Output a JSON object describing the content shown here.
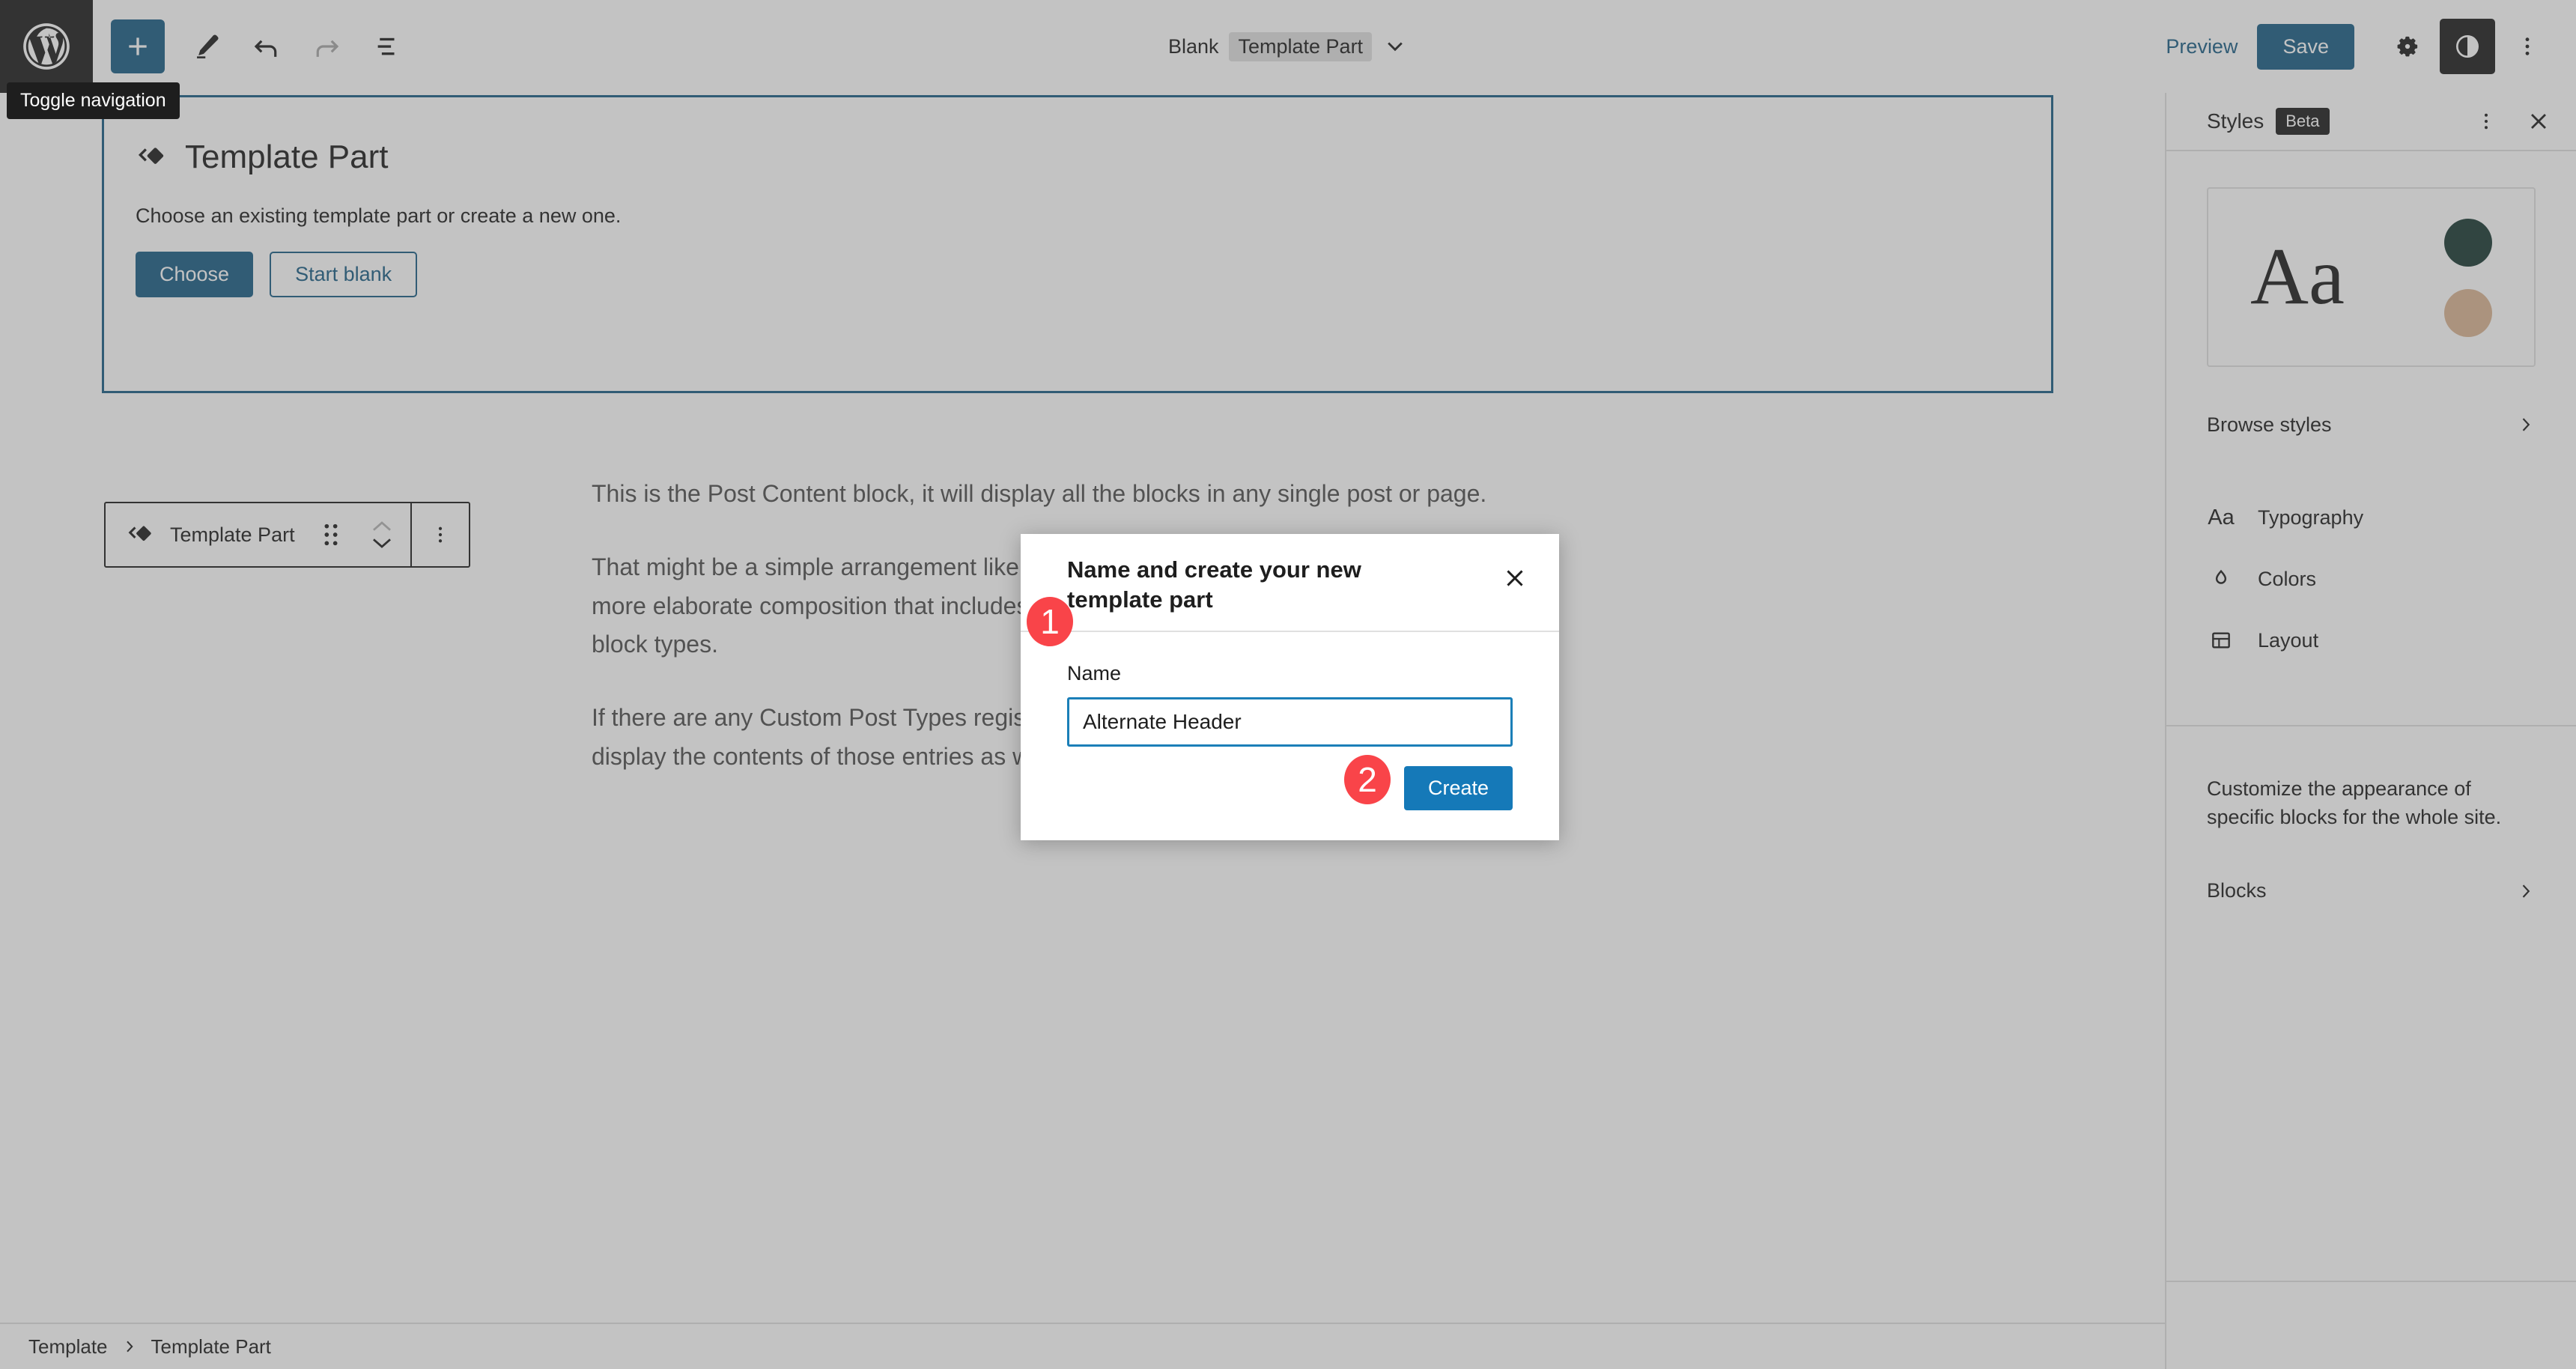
{
  "toolbar": {
    "wp_logo_icon": "wordpress-logo-icon",
    "add_block_icon": "plus-icon",
    "edit_icon": "pencil-icon",
    "undo_icon": "undo-arrow-icon",
    "redo_icon": "redo-arrow-icon",
    "list_view_icon": "list-view-icon",
    "tooltip": "Toggle navigation",
    "document_title": "Blank",
    "document_type_badge": "Template Part",
    "document_chevron_icon": "chevron-down-icon",
    "preview_label": "Preview",
    "save_label": "Save",
    "settings_icon": "gear-icon",
    "styles_icon": "contrast-half-circle-icon",
    "more_options_icon": "three-dots-vertical-icon"
  },
  "editor": {
    "template_part_block": {
      "icon": "template-part-icon",
      "heading": "Template Part",
      "description": "Choose an existing template part or create a new one.",
      "choose_label": "Choose",
      "start_blank_label": "Start blank"
    },
    "block_toolbar": {
      "block_icon": "template-part-icon",
      "block_label": "Template Part",
      "drag_handle_icon": "drag-handle-dots-icon",
      "move_up_icon": "chevron-up-icon",
      "move_down_icon": "chevron-down-icon",
      "options_icon": "three-dots-vertical-icon"
    },
    "post_content_paragraphs": [
      "This is the Post Content block, it will display all the blocks in any single post or page.",
      "That might be a simple arrangement like consecutive paragraphs in a blog post, or a more elaborate composition that includes video, image galleries, columns, and any other block types.",
      "If there are any Custom Post Types registered at your site, the Post Content block can display the contents of those entries as well."
    ]
  },
  "breadcrumb": {
    "items": [
      "Template",
      "Template Part"
    ],
    "separator_icon": "chevron-right-icon"
  },
  "sidebar": {
    "title": "Styles",
    "beta_badge": "Beta",
    "more_options_icon": "three-dots-vertical-icon",
    "close_icon": "close-x-icon",
    "preview": {
      "sample_text": "Aa",
      "swatch_primary_color": "#1b3a35",
      "swatch_secondary_color": "#d9b593"
    },
    "browse_styles": {
      "label": "Browse styles",
      "chevron_icon": "chevron-right-icon"
    },
    "menu_items": [
      {
        "label": "Typography",
        "icon": "typography-aa-icon"
      },
      {
        "label": "Colors",
        "icon": "color-droplet-icon"
      },
      {
        "label": "Layout",
        "icon": "layout-panel-icon"
      }
    ],
    "blocks_help_text": "Customize the appearance of specific blocks for the whole site.",
    "blocks_row": {
      "label": "Blocks",
      "chevron_icon": "chevron-right-icon"
    }
  },
  "modal": {
    "title": "Name and create your new template part",
    "close_icon": "close-x-icon",
    "name_label": "Name",
    "name_value": "Alternate Header",
    "name_placeholder": "",
    "create_label": "Create"
  },
  "annotations": [
    {
      "number": "1"
    },
    {
      "number": "2"
    }
  ],
  "colors": {
    "accent_blue": "#1b5e86",
    "create_blue": "#1579b8",
    "input_focus_blue": "#1b7fb8",
    "annotation_red": "#f94449",
    "dark": "#1e1e1e"
  }
}
